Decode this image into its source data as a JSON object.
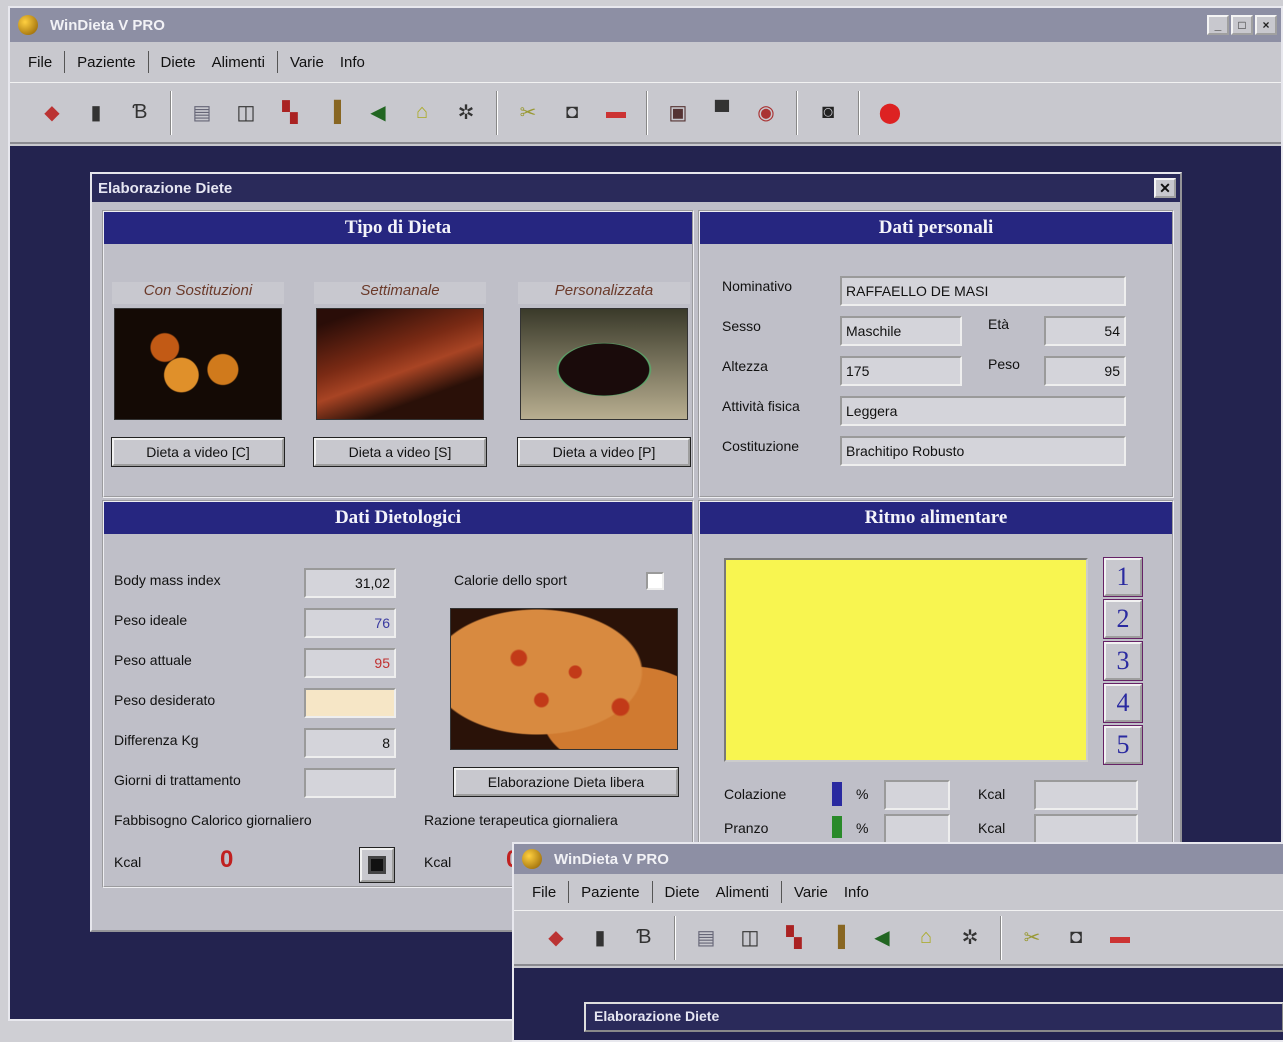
{
  "app": {
    "title": "WinDieta V   PRO"
  },
  "menu": [
    "File",
    "Paziente",
    "Diete",
    "Alimenti",
    "Varie",
    "Info"
  ],
  "toolbar_icons": [
    "patients-icon",
    "book-icon",
    "diet-icon",
    "print-icon",
    "columns-icon",
    "chart-icon",
    "bottle-icon",
    "arrow-icon",
    "weight-icon",
    "settings-icon",
    "scissors-icon",
    "copy-icon",
    "paste-icon",
    "calendar-icon",
    "basket-icon",
    "disk-icon",
    "floppy-icon",
    "exit-icon"
  ],
  "dialog": {
    "title": "Elaborazione Diete",
    "tipo": {
      "header": "Tipo di Dieta",
      "items": [
        {
          "caption": "Con Sostituzioni",
          "button": "Dieta a video [C]"
        },
        {
          "caption": "Settimanale",
          "button": "Dieta a video [S]"
        },
        {
          "caption": "Personalizzata",
          "button": "Dieta a video [P]"
        }
      ]
    },
    "personali": {
      "header": "Dati personali",
      "nominativo_label": "Nominativo",
      "nominativo": "RAFFAELLO DE MASI",
      "sesso_label": "Sesso",
      "sesso": "Maschile",
      "eta_label": "Età",
      "eta": "54",
      "altezza_label": "Altezza",
      "altezza": "175",
      "peso_label": "Peso",
      "peso": "95",
      "attivita_label": "Attività fisica",
      "attivita": "Leggera",
      "costituzione_label": "Costituzione",
      "costituzione": "Brachitipo Robusto"
    },
    "dietologici": {
      "header": "Dati Dietologici",
      "bmi_label": "Body mass index",
      "bmi": "31,02",
      "ideale_label": "Peso ideale",
      "ideale": "76",
      "attuale_label": "Peso attuale",
      "attuale": "95",
      "desiderato_label": "Peso desiderato",
      "desiderato": "",
      "differenza_label": "Differenza Kg",
      "differenza": "8",
      "giorni_label": "Giorni di trattamento",
      "giorni": "",
      "calorie_sport_label": "Calorie dello sport",
      "elab_button": "Elaborazione Dieta libera",
      "fabbisogno_label": "Fabbisogno Calorico giornaliero",
      "razione_label": "Razione terapeutica giornaliera",
      "kcal_label": "Kcal",
      "kcal_value": "0",
      "kcal2_label": "Kcal",
      "kcal2_value": "0"
    },
    "ritmo": {
      "header": "Ritmo alimentare",
      "buttons": [
        "1",
        "2",
        "3",
        "4",
        "5"
      ],
      "colazione_label": "Colazione",
      "pranzo_label": "Pranzo",
      "pct": "%",
      "kcal": "Kcal"
    }
  },
  "second_window": {
    "title": "WinDieta V   PRO",
    "dialog_title": "Elaborazione Diete"
  }
}
